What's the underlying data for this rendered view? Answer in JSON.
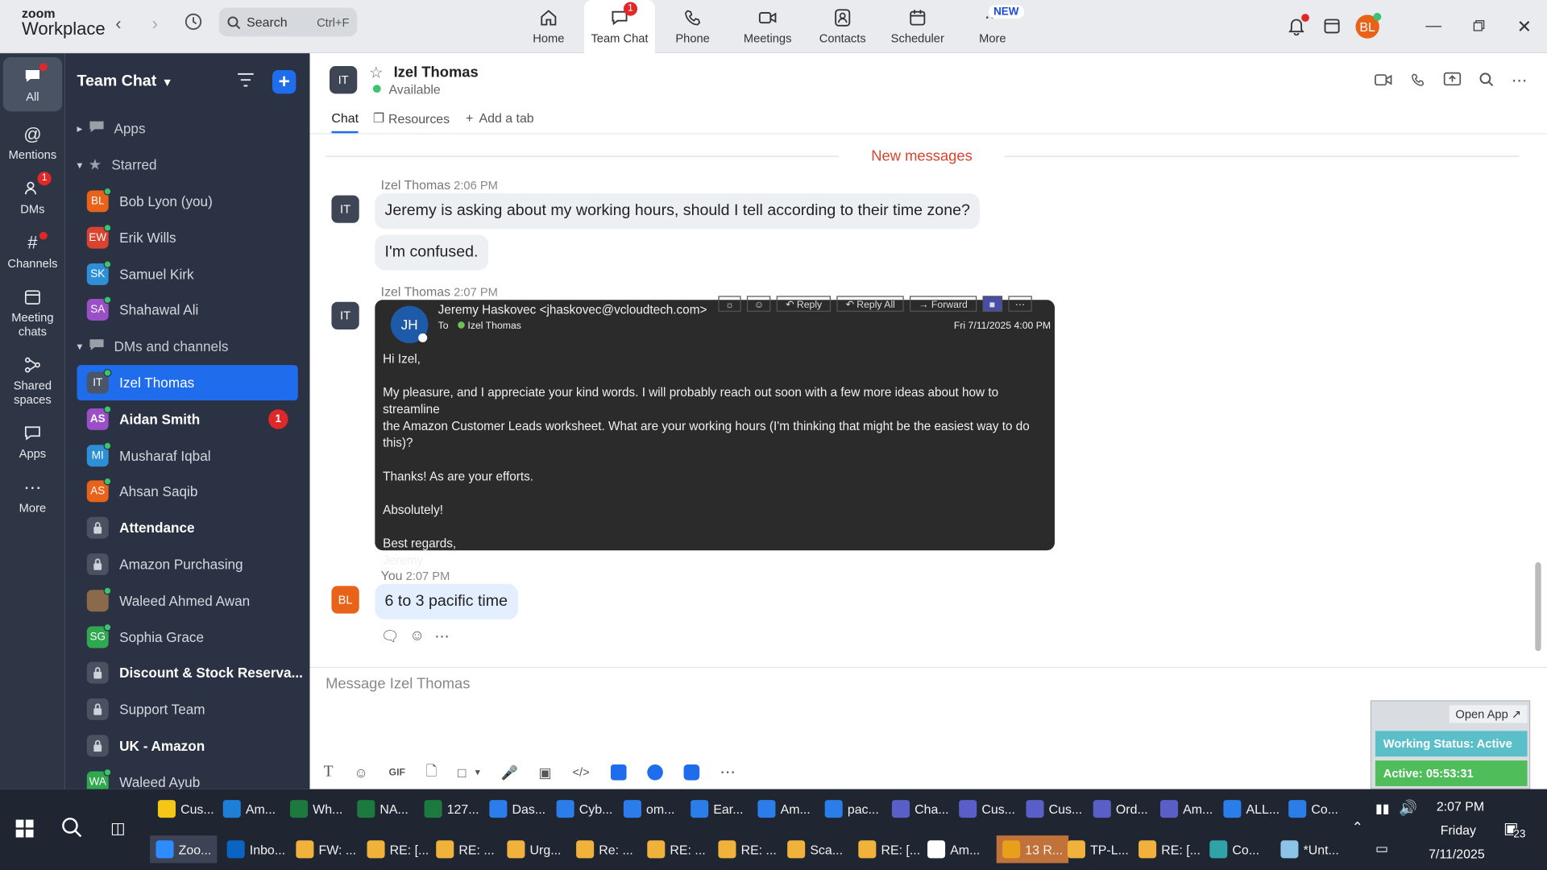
{
  "app": {
    "brand_top": "zoom",
    "brand_bottom": "Workplace"
  },
  "search": {
    "label": "Search",
    "shortcut": "Ctrl+F"
  },
  "tabs": [
    {
      "label": "Home",
      "icon": "home-icon"
    },
    {
      "label": "Team Chat",
      "icon": "chat-icon",
      "badge": "1"
    },
    {
      "label": "Phone",
      "icon": "phone-icon"
    },
    {
      "label": "Meetings",
      "icon": "video-icon"
    },
    {
      "label": "Contacts",
      "icon": "contacts-icon"
    },
    {
      "label": "Scheduler",
      "icon": "calendar-icon"
    },
    {
      "label": "More",
      "icon": "more-icon",
      "badge": "NEW"
    }
  ],
  "user": {
    "initials": "BL",
    "color": "#e8621a"
  },
  "rail": [
    {
      "label": "All"
    },
    {
      "label": "Mentions"
    },
    {
      "label": "DMs",
      "badge": "1"
    },
    {
      "label": "Channels"
    },
    {
      "label": "Meeting chats"
    },
    {
      "label": "Shared spaces"
    },
    {
      "label": "Apps"
    },
    {
      "label": "More"
    }
  ],
  "sidebar": {
    "title": "Team Chat",
    "apps": "Apps",
    "starred": "Starred",
    "starred_items": [
      {
        "initials": "BL",
        "name": "Bob Lyon (you)",
        "color": "#e8621a"
      },
      {
        "initials": "EW",
        "name": "Erik Wills",
        "color": "#d9432f"
      },
      {
        "initials": "SK",
        "name": "Samuel Kirk",
        "color": "#2f8fd6"
      },
      {
        "initials": "SA",
        "name": "Shahawal Ali",
        "color": "#9b4fc7"
      }
    ],
    "dms_section": "DMs and channels",
    "dm_items": [
      {
        "initials": "IT",
        "name": "Izel Thomas",
        "color": "#4a5568"
      },
      {
        "initials": "AS",
        "name": "Aidan Smith",
        "color": "#9b4fc7",
        "badge": "1"
      },
      {
        "initials": "MI",
        "name": "Musharaf Iqbal",
        "color": "#2f8fd6"
      },
      {
        "initials": "AS",
        "name": "Ahsan Saqib",
        "color": "#e8621a"
      },
      {
        "name": "Attendance"
      },
      {
        "name": "Amazon Purchasing"
      },
      {
        "initials": "",
        "name": "Waleed Ahmed Awan",
        "color": "#8a6a4a"
      },
      {
        "initials": "SG",
        "name": "Sophia Grace",
        "color": "#2fa84f"
      },
      {
        "name": "Discount & Stock Reserva..."
      },
      {
        "name": "Support Team"
      },
      {
        "name": "UK - Amazon"
      },
      {
        "initials": "WA",
        "name": "Waleed Ayub",
        "color": "#2fa84f"
      }
    ]
  },
  "chat": {
    "contact_initials": "IT",
    "contact_name": "Izel Thomas",
    "status": "Available",
    "tab_chat": "Chat",
    "tab_resources": "Resources",
    "tab_add": "Add a tab",
    "new_messages": "New messages",
    "m1_sender": "Izel Thomas",
    "m1_time": "2:06 PM",
    "m1_text1": "Jeremy is asking about my working hours, should I tell according to their time zone?",
    "m1_text2": "I'm confused.",
    "m2_sender": "Izel Thomas",
    "m2_time": "2:07 PM",
    "email": {
      "initials": "JH",
      "from": "Jeremy Haskovec <jhaskovec@vcloudtech.com>",
      "to_label": "To",
      "to": "Izel Thomas",
      "date": "Fri 7/11/2025 4:00 PM",
      "reply": "Reply",
      "reply_all": "Reply All",
      "forward": "Forward",
      "greeting": "Hi Izel,",
      "body1": "My pleasure, and I appreciate your kind words.  I will probably reach out soon with a few more ideas about how to streamline",
      "body2": "the Amazon Customer Leads worksheet.  What are your working hours (I'm thinking that might be the easiest way to do this)?",
      "thanks": "Thanks! As are your efforts.",
      "absolutely": "Absolutely!",
      "regards": "Best regards,",
      "signoff": "Jeremy"
    },
    "m3_sender": "You",
    "m3_time": "2:07 PM",
    "m3_text": "6 to 3 pacific time",
    "composer_placeholder": "Message Izel Thomas"
  },
  "widget": {
    "open_app": "Open App ↗",
    "working_status": "Working Status: Active",
    "active": "Active: 05:53:31"
  },
  "taskbar": {
    "row1": [
      "Cus...",
      "Am...",
      "Wh...",
      "NA...",
      "127...",
      "Das...",
      "Cyb...",
      "om...",
      "Ear...",
      "Am...",
      "pac...",
      "Cha...",
      "Cus...",
      "Cus...",
      "Ord...",
      "Am...",
      "ALL...",
      "Co..."
    ],
    "row2": [
      "Zoo...",
      "Inbo...",
      "FW: ...",
      "RE: [...",
      "RE: ...",
      "Urg...",
      "Re: ...",
      "RE: ...",
      "RE: ...",
      "Sca...",
      "RE: [...",
      "Am...",
      "13 R...",
      "TP-L...",
      "RE: [...",
      "Co...",
      "*Unt..."
    ],
    "time": "2:07 PM",
    "day": "Friday",
    "date": "7/11/2025",
    "notif": "23"
  }
}
